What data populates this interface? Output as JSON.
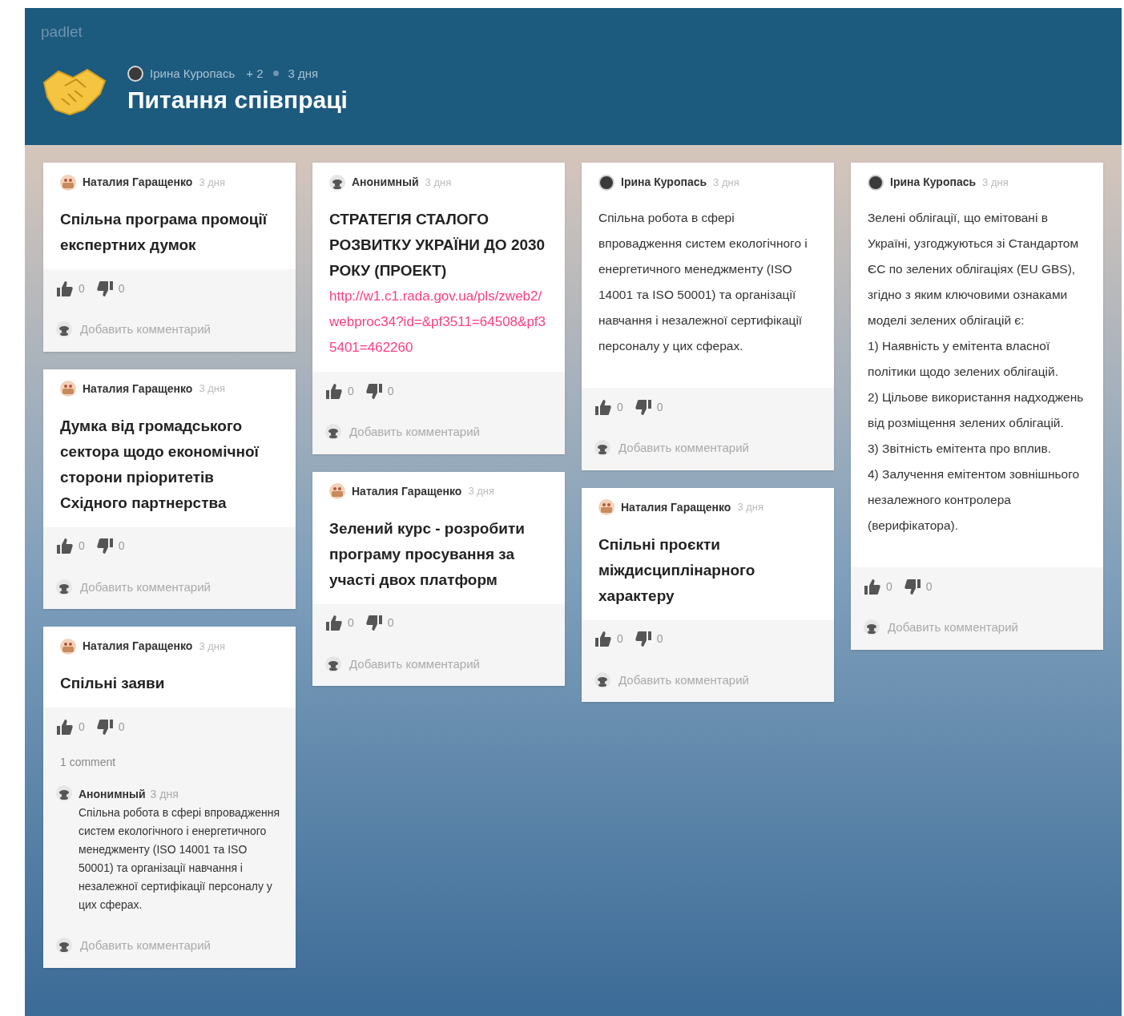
{
  "app": {
    "logo": "padlet"
  },
  "board": {
    "author": "Ірина Куропась",
    "contributors": "+ 2",
    "time": "3 дня",
    "title": "Питання співпраці"
  },
  "columns": [
    {
      "posts": [
        {
          "author": {
            "name": "Наталия Гаращенко",
            "avatar": {
              "kind": "drawing"
            }
          },
          "time": "3 дня",
          "content": {
            "kind": "title",
            "text": "Спільна програма промоції експертних думок"
          },
          "likes": "0",
          "dislikes": "0",
          "add_comment": "Добавить комментарий"
        },
        {
          "author": {
            "name": "Наталия Гаращенко",
            "avatar": {
              "kind": "drawing"
            }
          },
          "time": "3 дня",
          "content": {
            "kind": "title",
            "text": "Думка від громадського сектора щодо економічної сторони пріоритетів Східного партнерства"
          },
          "likes": "0",
          "dislikes": "0",
          "add_comment": "Добавить комментарий"
        },
        {
          "author": {
            "name": "Наталия Гаращенко",
            "avatar": {
              "kind": "drawing"
            }
          },
          "time": "3 дня",
          "content": {
            "kind": "title",
            "text": "Спільні заяви"
          },
          "likes": "0",
          "dislikes": "0",
          "comments_label": "1 comment",
          "comments": [
            {
              "author": {
                "name": "Анонимный",
                "avatar": {
                  "kind": "anonymous"
                }
              },
              "time": "3 дня",
              "text": "Спільна робота в сфері впровадження систем екологічного і енергетичного менеджменту (ISO 14001 та ISO 50001) та організації навчання і незалежної сертифікації персоналу у цих сферах."
            }
          ],
          "add_comment": "Добавить комментарий"
        }
      ]
    },
    {
      "posts": [
        {
          "author": {
            "name": "Анонимный",
            "avatar": {
              "kind": "anonymous"
            }
          },
          "time": "3 дня",
          "content": {
            "kind": "title",
            "text": "СТРАТЕГІЯ СТАЛОГО РОЗВИТКУ УКРАЇНИ ДО 2030 РОКУ (ПРОЕКТ)"
          },
          "link": "http://w1.c1.rada.gov.ua/pls/zweb2/webproc34?id=&pf3511=64508&pf35401=462260",
          "likes": "0",
          "dislikes": "0",
          "add_comment": "Добавить комментарий"
        },
        {
          "author": {
            "name": "Наталия Гаращенко",
            "avatar": {
              "kind": "drawing"
            }
          },
          "time": "3 дня",
          "content": {
            "kind": "title",
            "text": "Зелений курс - розробити програму просування за участі двох платформ"
          },
          "likes": "0",
          "dislikes": "0",
          "add_comment": "Добавить комментарий"
        }
      ]
    },
    {
      "posts": [
        {
          "author": {
            "name": "Ірина Куропась",
            "avatar": {
              "kind": "photo"
            }
          },
          "time": "3 дня",
          "content": {
            "kind": "text",
            "text": "Спільна робота в сфері впровадження систем екологічного і енергетичного менеджменту (ISO 14001 та ISO 50001) та організації навчання і незалежної сертифікації персоналу у цих сферах."
          },
          "likes": "0",
          "dislikes": "0",
          "add_comment": "Добавить комментарий"
        },
        {
          "author": {
            "name": "Наталия Гаращенко",
            "avatar": {
              "kind": "drawing"
            }
          },
          "time": "3 дня",
          "content": {
            "kind": "title",
            "text": "Спільні проєкти міждисциплінарного характеру"
          },
          "likes": "0",
          "dislikes": "0",
          "add_comment": "Добавить комментарий"
        }
      ]
    },
    {
      "posts": [
        {
          "author": {
            "name": "Ірина Куропась",
            "avatar": {
              "kind": "photo"
            }
          },
          "time": "3 дня",
          "content": {
            "kind": "text",
            "text": "Зелені облігації, що емітовані в Україні, узгоджуються зі Стандартом ЄС по зелених облігаціях (EU GBS), згідно з яким ключовими ознаками моделі зелених облігацій є:\n1) Наявність у емітента власної політики щодо зелених облігацій.\n2) Цільове використання надходжень від розміщення зелених облігацій.\n3) Звітність емітента про вплив.\n4) Залучення емітентом зовнішнього незалежного контролера (верифікатора)."
          },
          "likes": "0",
          "dislikes": "0",
          "add_comment": "Добавить комментарий"
        }
      ]
    }
  ]
}
